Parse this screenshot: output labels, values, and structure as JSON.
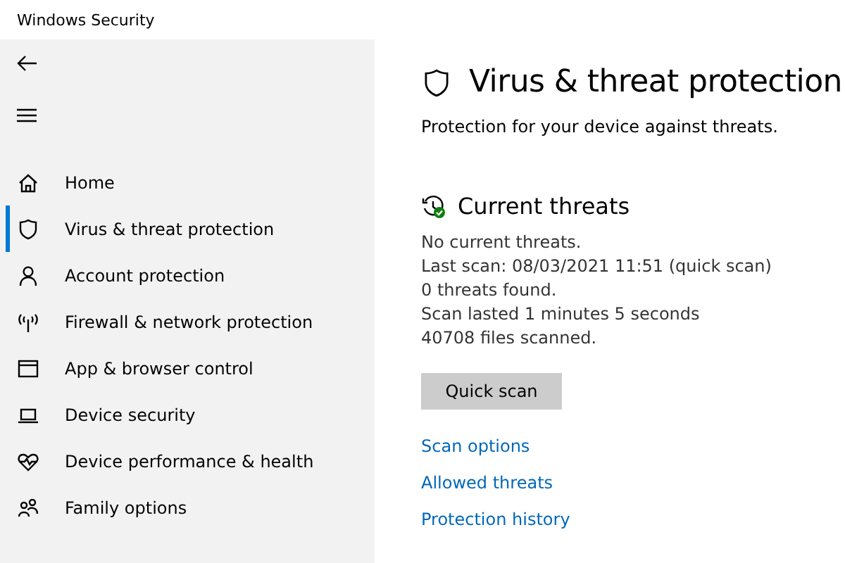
{
  "window": {
    "title": "Windows Security"
  },
  "sidebar": {
    "items": [
      {
        "label": "Home",
        "kind": "home",
        "selected": false
      },
      {
        "label": "Virus & threat protection",
        "kind": "shield",
        "selected": true
      },
      {
        "label": "Account protection",
        "kind": "person",
        "selected": false
      },
      {
        "label": "Firewall & network protection",
        "kind": "antenna",
        "selected": false
      },
      {
        "label": "App & browser control",
        "kind": "browser",
        "selected": false
      },
      {
        "label": "Device security",
        "kind": "laptop",
        "selected": false
      },
      {
        "label": "Device performance & health",
        "kind": "heart",
        "selected": false
      },
      {
        "label": "Family options",
        "kind": "family",
        "selected": false
      }
    ]
  },
  "page": {
    "title": "Virus & threat protection",
    "subtitle": "Protection for your device against threats.",
    "section": {
      "title": "Current threats",
      "lines": [
        "No current threats.",
        "Last scan: 08/03/2021 11:51 (quick scan)",
        "0 threats found.",
        "Scan lasted 1 minutes 5 seconds",
        "40708 files scanned."
      ],
      "button": "Quick scan",
      "links": [
        "Scan options",
        "Allowed threats",
        "Protection history"
      ]
    }
  }
}
